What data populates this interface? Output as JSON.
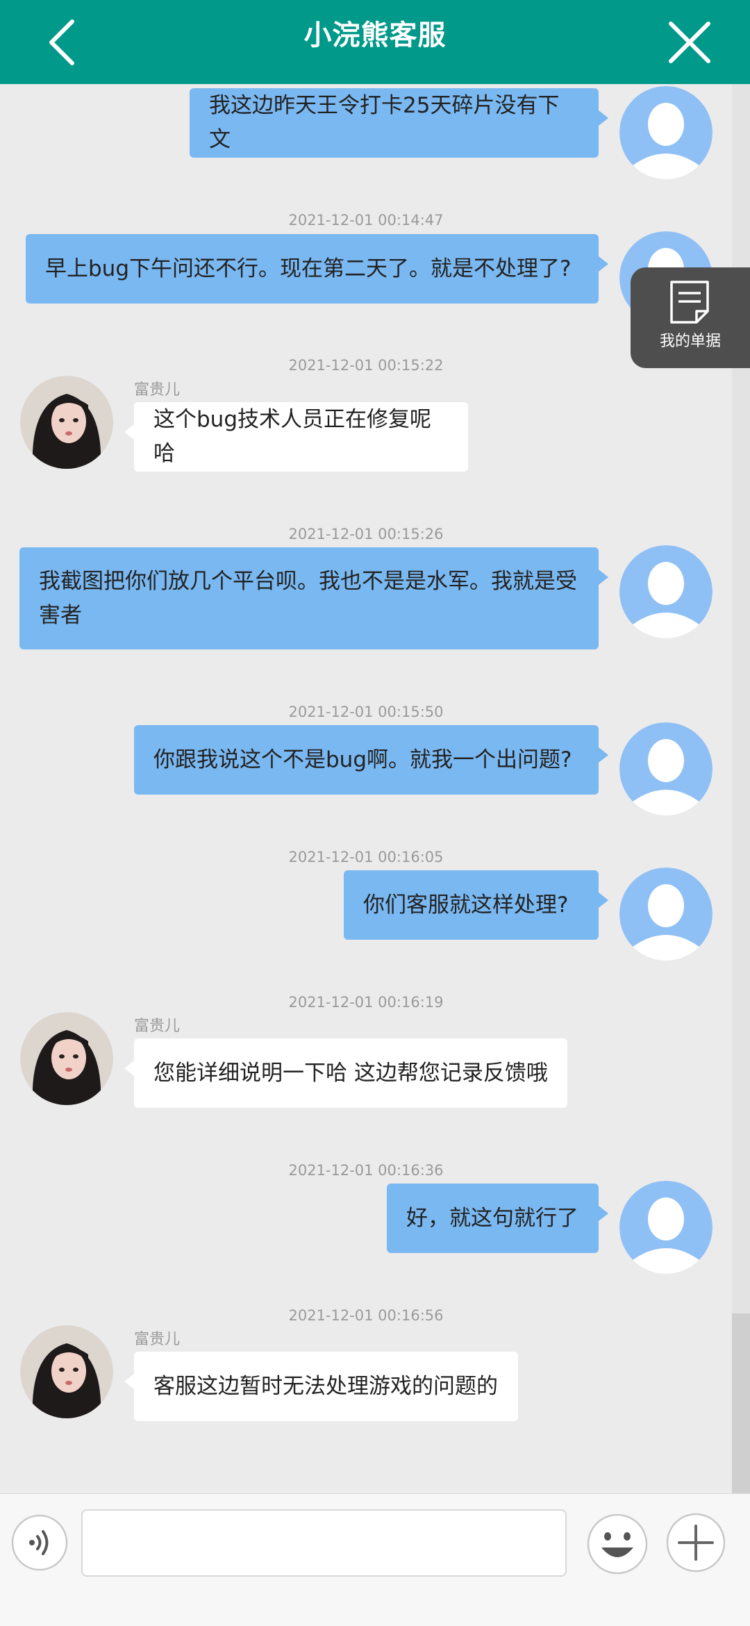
{
  "header": {
    "title": "小浣熊客服",
    "back_icon": "chevron-left-icon",
    "close_icon": "close-icon"
  },
  "floating": {
    "my_orders_label": "我的单据",
    "icon": "document-icon"
  },
  "agent": {
    "name": "富贵儿"
  },
  "messages": [
    {
      "side": "right",
      "time": "",
      "text": "我这边昨天王令打卡25天碎片没有下文"
    },
    {
      "side": "right",
      "time": "2021-12-01 00:14:47",
      "text": "早上bug下午问还不行。现在第二天了。就是不处理了?"
    },
    {
      "side": "left",
      "time": "2021-12-01 00:15:22",
      "sender": "富贵儿",
      "text": "这个bug技术人员正在修复呢哈"
    },
    {
      "side": "right",
      "time": "2021-12-01 00:15:26",
      "text": "我截图把你们放几个平台呗。我也不是是水军。我就是受害者"
    },
    {
      "side": "right",
      "time": "2021-12-01 00:15:50",
      "text": "你跟我说这个不是bug啊。就我一个出问题?"
    },
    {
      "side": "right",
      "time": "2021-12-01 00:16:05",
      "text": "你们客服就这样处理?"
    },
    {
      "side": "left",
      "time": "2021-12-01 00:16:19",
      "sender": "富贵儿",
      "text": "您能详细说明一下哈 这边帮您记录反馈哦"
    },
    {
      "side": "right",
      "time": "2021-12-01 00:16:36",
      "text": "好，就这句就行了"
    },
    {
      "side": "left",
      "time": "2021-12-01 00:16:56",
      "sender": "富贵儿",
      "text": "客服这边暂时无法处理游戏的问题的"
    }
  ],
  "input_bar": {
    "voice_icon": "voice-icon",
    "placeholder": "",
    "emoji_icon": "emoji-icon",
    "plus_icon": "plus-icon"
  },
  "colors": {
    "header": "#00998a",
    "user_bubble": "#7ab8f1",
    "agent_bubble": "#ffffff",
    "background": "#ebebeb"
  }
}
